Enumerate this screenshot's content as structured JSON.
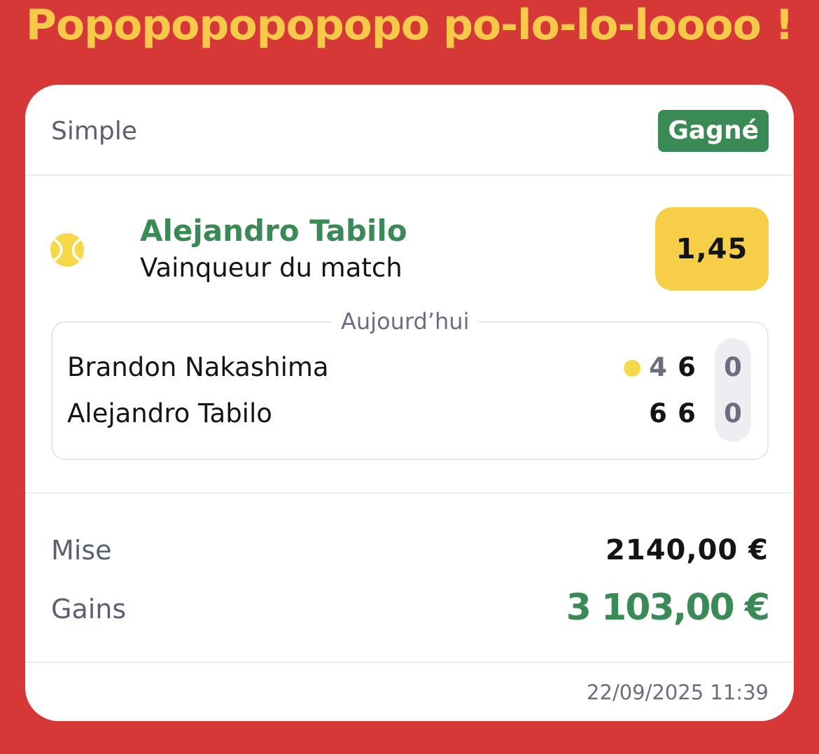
{
  "headline": "Popopopopopopo po-lo-lo-loooo !",
  "bet": {
    "type": "Simple",
    "status": "Gagné",
    "selection": "Alejandro Tabilo",
    "market": "Vainqueur du match",
    "odds": "1,45",
    "sport_icon": "tennis-ball-icon"
  },
  "match": {
    "date_label": "Aujourd’hui",
    "players": [
      {
        "name": "Brandon Nakashima",
        "sets": [
          "4",
          "6"
        ],
        "games": "0",
        "serving": true
      },
      {
        "name": "Alejandro Tabilo",
        "sets": [
          "6",
          "6"
        ],
        "games": "0",
        "serving": false
      }
    ]
  },
  "summary": {
    "stake_label": "Mise",
    "stake_value": "2140,00 €",
    "gains_label": "Gains",
    "gains_value": "3 103,00 €"
  },
  "timestamp": "22/09/2025 11:39",
  "colors": {
    "background": "#d63838",
    "headline": "#f7c948",
    "win_green": "#3a8a55",
    "odds_yellow": "#f6ce47",
    "muted_text": "#6a6f80"
  }
}
